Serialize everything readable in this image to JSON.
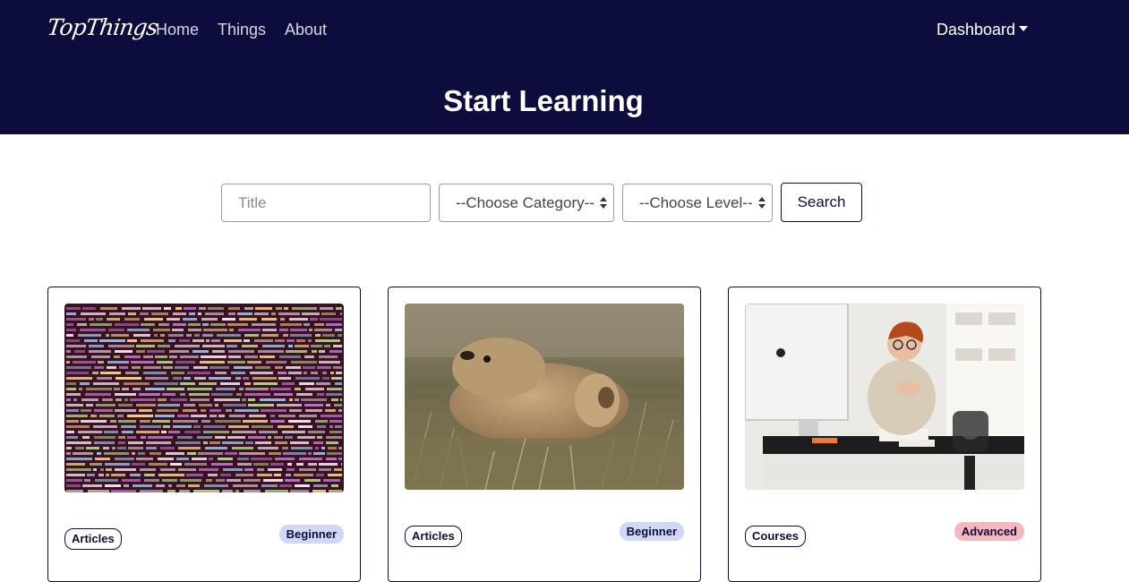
{
  "nav": {
    "brand": "TopThings",
    "links": [
      "Home",
      "Things",
      "About"
    ],
    "dashboard": "Dashboard"
  },
  "hero": {
    "title": "Start Learning"
  },
  "filters": {
    "title_placeholder": "Title",
    "category_value": "--Choose Category--",
    "level_value": "--Choose Level--",
    "search_label": "Search"
  },
  "cards": [
    {
      "type": "Articles",
      "level": "Beginner",
      "image": "code-screen"
    },
    {
      "type": "Articles",
      "level": "Beginner",
      "image": "prairie-dog"
    },
    {
      "type": "Courses",
      "level": "Advanced",
      "image": "woman-at-desk"
    }
  ],
  "colors": {
    "navbar": "#0d0d3d",
    "beginner_badge": "#cfd8f5",
    "advanced_badge": "#f5b6bf"
  }
}
